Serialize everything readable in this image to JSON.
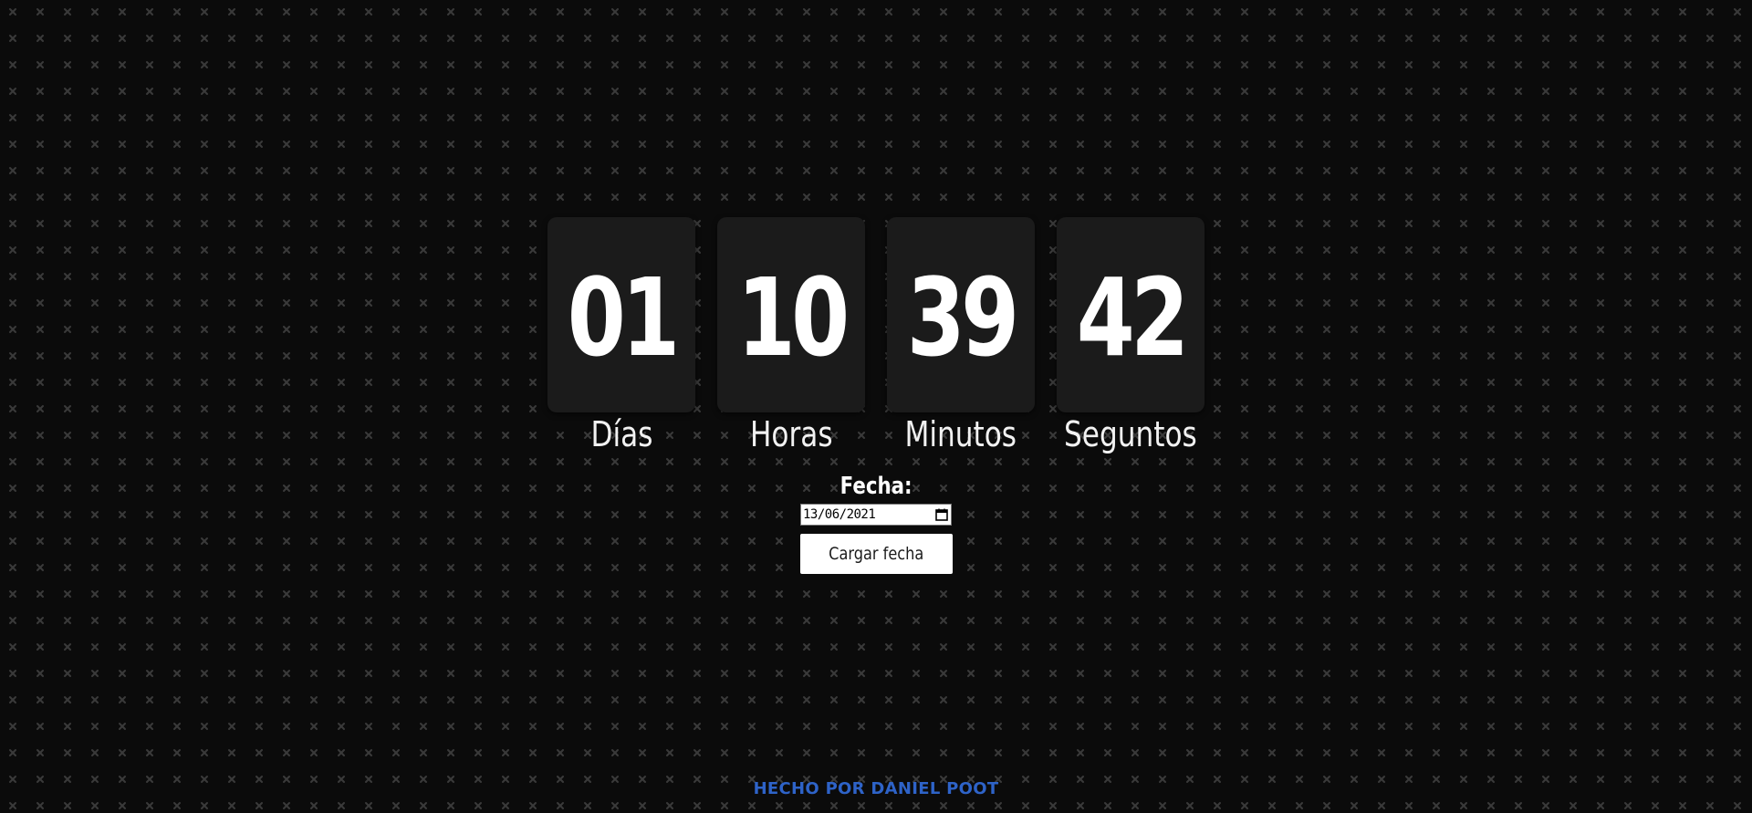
{
  "colors": {
    "background": "#0b0b0b",
    "pattern": "#3a3a3a",
    "card": "#1b1b1b",
    "text": "#ffffff",
    "footer": "#2e63c8"
  },
  "countdown": [
    {
      "value": "01",
      "label": "Días"
    },
    {
      "value": "10",
      "label": "Horas"
    },
    {
      "value": "39",
      "label": "Minutos"
    },
    {
      "value": "42",
      "label": "Seguntos"
    }
  ],
  "form": {
    "label": "Fecha:",
    "date_value": "13/06/2021",
    "calendar_icon": "calendar-icon",
    "button_label": "Cargar fecha"
  },
  "footer": {
    "text": "HECHO POR DANIEL POOT"
  }
}
